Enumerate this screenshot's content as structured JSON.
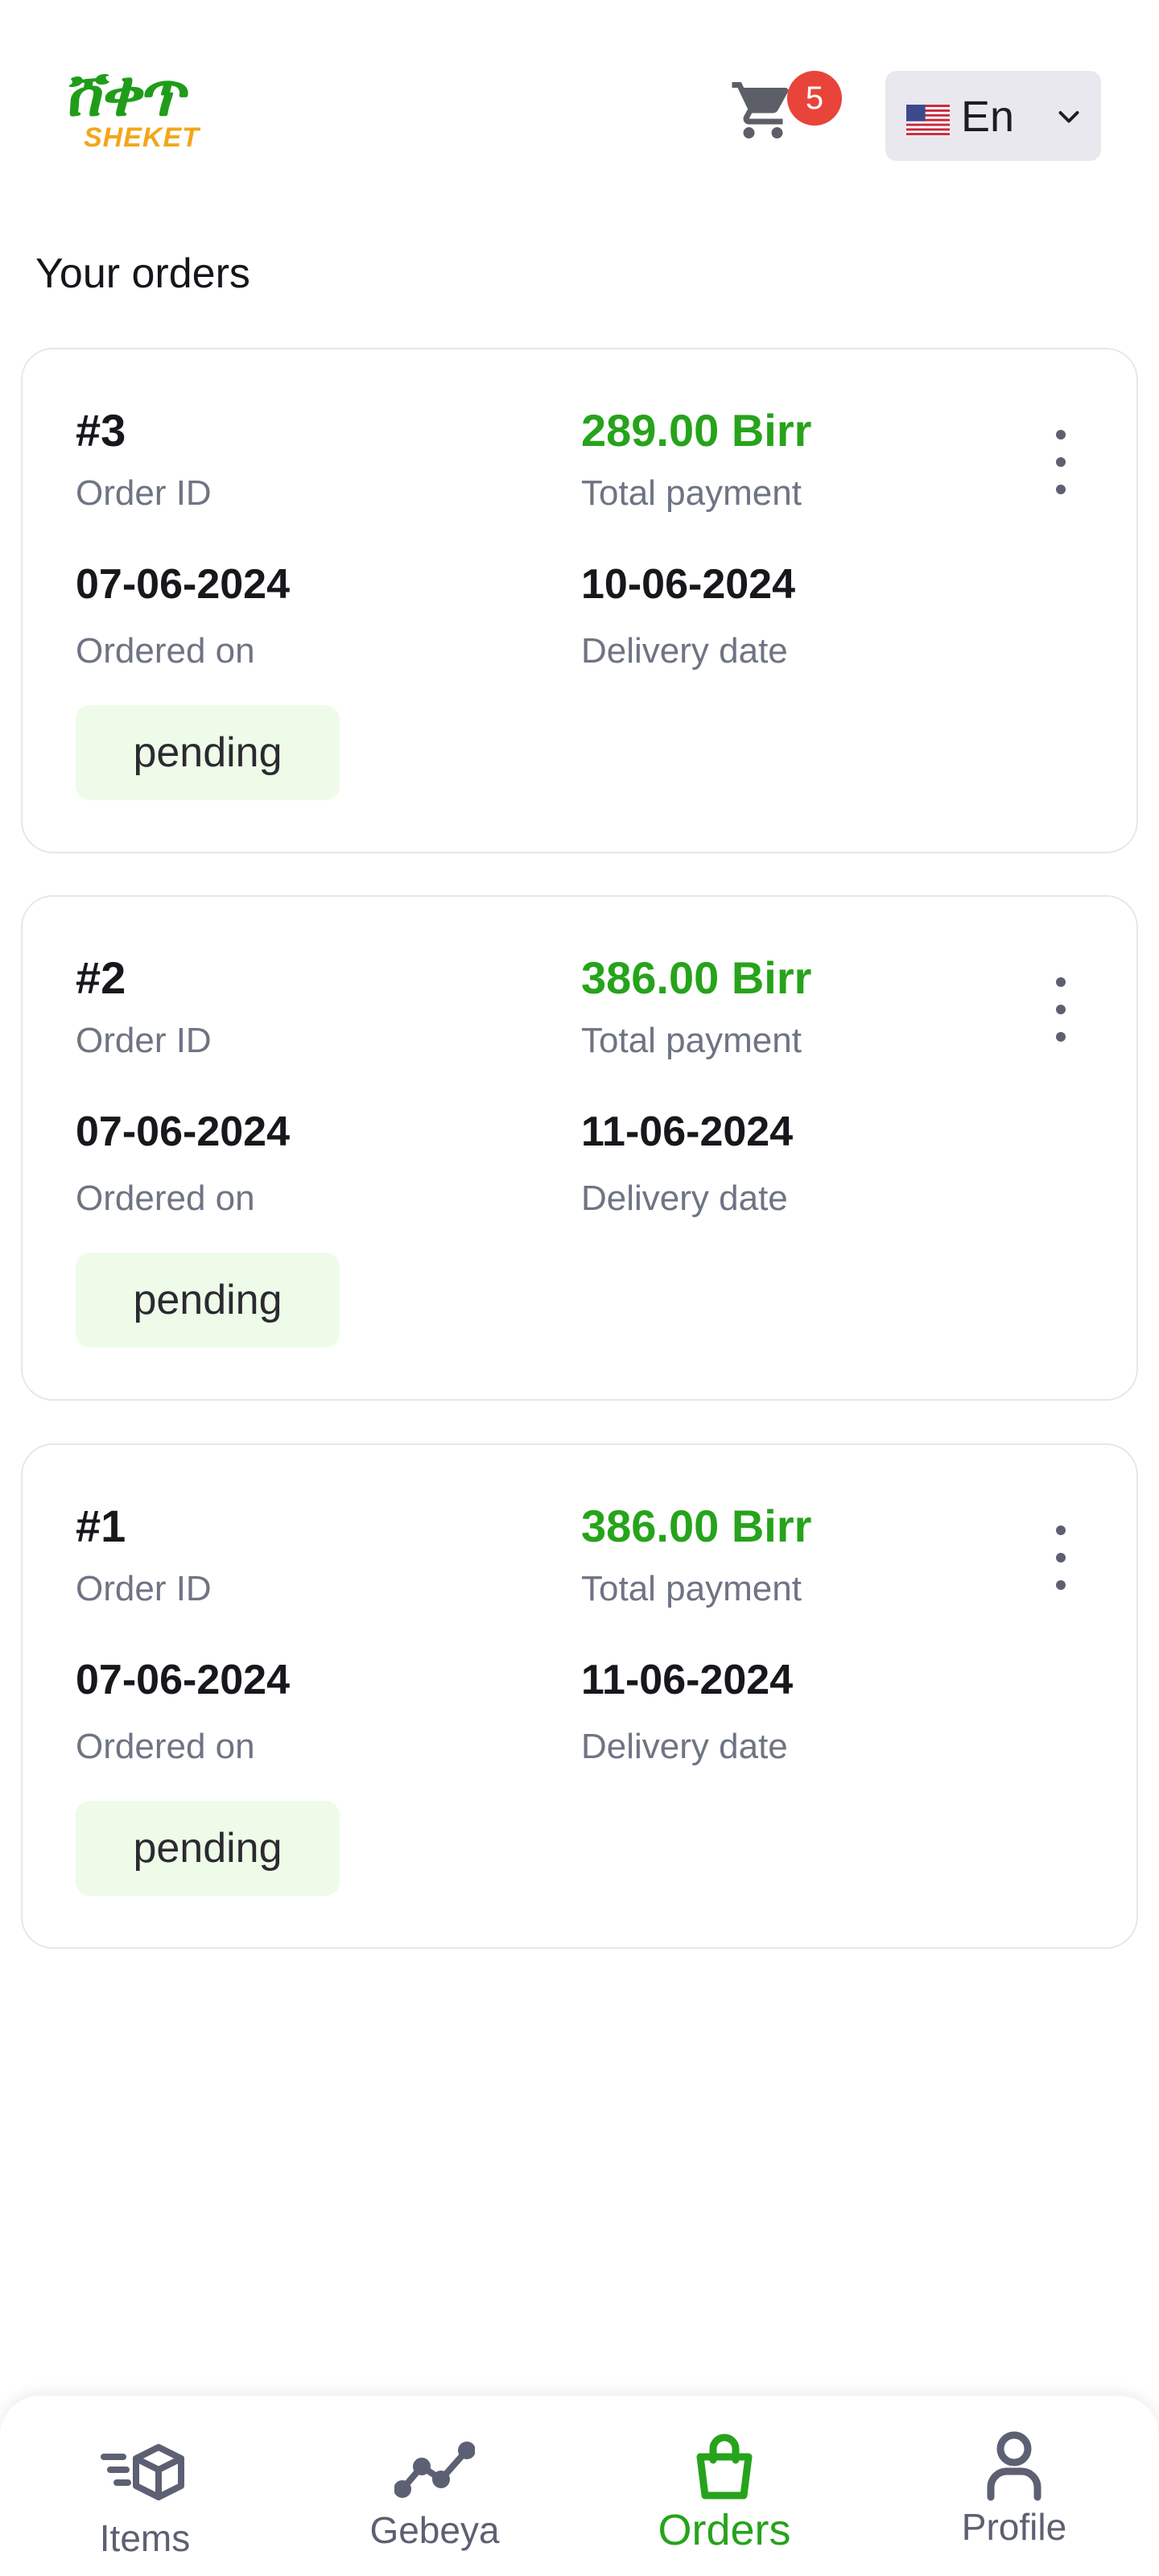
{
  "header": {
    "logo_script": "ሸቀጥ",
    "logo_word": "SHEKET",
    "cart_count": "5",
    "language": "En",
    "icons": {
      "cart": "cart-icon",
      "flag": "us-flag-icon",
      "dropdown": "chevron-down-icon"
    }
  },
  "page": {
    "title": "Your orders"
  },
  "labels": {
    "order_id": "Order ID",
    "total_payment": "Total payment",
    "ordered_on": "Ordered on",
    "delivery_date": "Delivery date"
  },
  "orders": [
    {
      "id": "#3",
      "total": "289.00 Birr",
      "ordered_on": "07-06-2024",
      "delivery_date": "10-06-2024",
      "status": "pending"
    },
    {
      "id": "#2",
      "total": "386.00 Birr",
      "ordered_on": "07-06-2024",
      "delivery_date": "11-06-2024",
      "status": "pending"
    },
    {
      "id": "#1",
      "total": "386.00 Birr",
      "ordered_on": "07-06-2024",
      "delivery_date": "11-06-2024",
      "status": "pending"
    }
  ],
  "bottom_nav": {
    "items": [
      {
        "label": "Items",
        "icon": "box-icon"
      },
      {
        "label": "Gebeya",
        "icon": "trend-line-icon"
      },
      {
        "label": "Orders",
        "icon": "shopping-bag-icon",
        "active": true
      },
      {
        "label": "Profile",
        "icon": "user-icon"
      }
    ]
  },
  "colors": {
    "accent": "#26a31b",
    "badge": "#e8443a",
    "status_bg": "#eefbe9",
    "muted_text": "#6e7484"
  }
}
